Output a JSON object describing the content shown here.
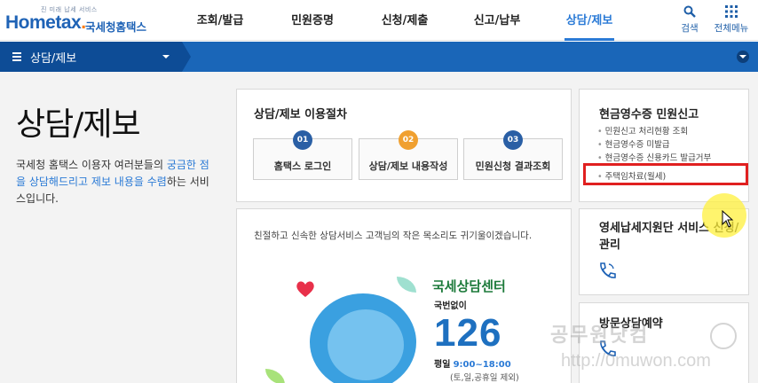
{
  "header": {
    "logo_tagline": "진 미래 납세 서비스",
    "logo_word_a": "Hom",
    "logo_word_b": "e",
    "logo_word_c": "tax",
    "logo_word_dot": ".",
    "logo_sub": "국세청홈택스",
    "nav": [
      {
        "label": "조회/발급",
        "active": false
      },
      {
        "label": "민원증명",
        "active": false
      },
      {
        "label": "신청/제출",
        "active": false
      },
      {
        "label": "신고/납부",
        "active": false
      },
      {
        "label": "상담/제보",
        "active": true
      }
    ],
    "search_label": "검색",
    "all_menu_label": "전체메뉴"
  },
  "subbar": {
    "title": "상담/제보"
  },
  "left": {
    "title": "상담/제보",
    "desc_part1": "국세청 홈택스 이용자 여러분들의 ",
    "desc_hl1": "궁금한 점을 상담해드리고 제보 내용을 수렴",
    "desc_part2": "하는 서비스입니다."
  },
  "procedure": {
    "title": "상담/제보 이용절차",
    "steps": [
      {
        "num": "01",
        "label": "홈택스 로그인"
      },
      {
        "num": "02",
        "label": "상담/제보 내용작성"
      },
      {
        "num": "03",
        "label": "민원신청 결과조회"
      }
    ]
  },
  "center": {
    "intro": "친절하고 신속한 상담서비스 고객님의 작은 목소리도 귀기울이겠습니다.",
    "center_name": "국세상담센터",
    "no_area": "국번없이",
    "phone": "126",
    "hours_label": "평일",
    "hours_time": "9:00~18:00",
    "holiday": "(토,일,공휴일 제외)"
  },
  "cash_receipt": {
    "title": "현금영수증 민원신고",
    "items": [
      "민원신고 처리현황 조회",
      "현금영수증 미발급",
      "현금영수증 신용카드 발급거부"
    ],
    "highlighted_item": "주택임차료(월세)"
  },
  "small_business": {
    "title": "영세납세지원단 서비스 신청/관리"
  },
  "visit": {
    "title": "방문상담예약"
  },
  "watermark": {
    "line1": "공무원닷컴",
    "line2": "http://0muwon.com"
  },
  "colors": {
    "primary_blue": "#1a66b8",
    "dark_blue": "#0d4c96",
    "highlight_red": "#e02020",
    "accent_orange": "#f0a030"
  }
}
